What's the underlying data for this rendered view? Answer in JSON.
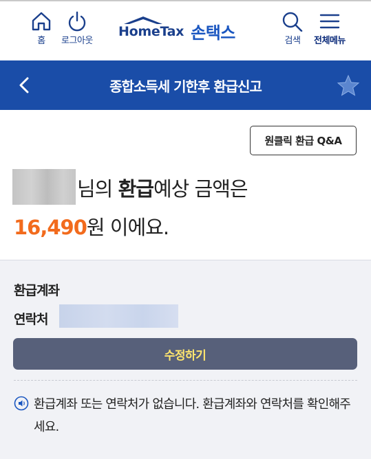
{
  "header": {
    "home_label": "홈",
    "logout_label": "로그아웃",
    "logo_text": "HomeTax",
    "logo_suffix": "손택스",
    "search_label": "검색",
    "menu_label": "전체메뉴"
  },
  "titlebar": {
    "title": "종합소득세 기한후 환급신고"
  },
  "summary": {
    "qa_button": "원클릭 환급 Q&A",
    "line1_prefix": "님의 ",
    "line1_bold": "환급",
    "line1_suffix": "예상 금액은",
    "amount": "16,490",
    "line2_suffix": "원 이에요."
  },
  "account": {
    "account_label": "환급계좌",
    "contact_label": "연락처",
    "edit_button": "수정하기",
    "notice": "환급계좌 또는 연락처가 없습니다. 환급계좌와 연락처를 확인해주세요."
  },
  "colors": {
    "brand_blue": "#1a4da8",
    "amount_orange": "#f26b1d",
    "edit_button_bg": "#57607a",
    "edit_button_text": "#ffe66e"
  },
  "icons": [
    "home-icon",
    "power-icon",
    "search-icon",
    "hamburger-menu-icon",
    "back-arrow-icon",
    "bookmark-star-icon",
    "speaker-icon"
  ]
}
